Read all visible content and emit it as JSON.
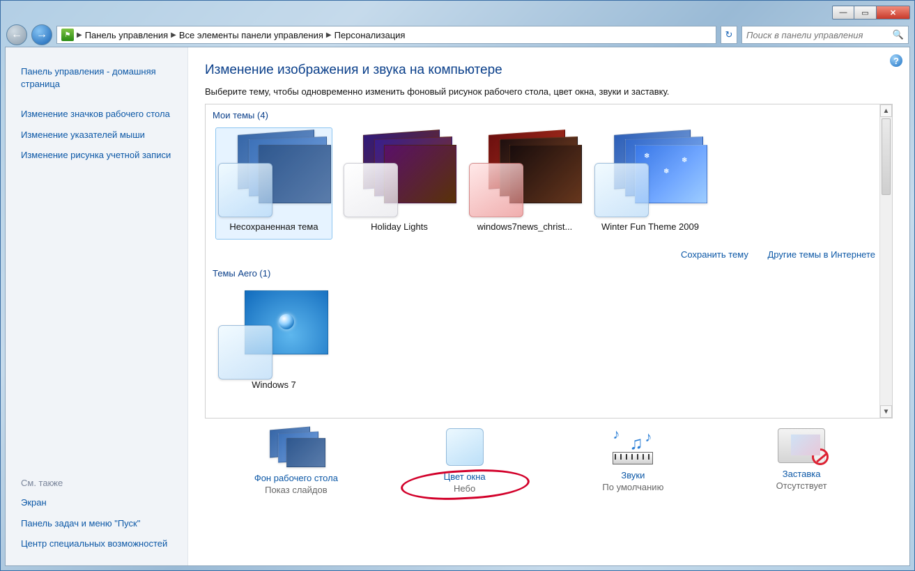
{
  "breadcrumb": {
    "items": [
      "Панель управления",
      "Все элементы панели управления",
      "Персонализация"
    ]
  },
  "search": {
    "placeholder": "Поиск в панели управления"
  },
  "sidebar": {
    "home": "Панель управления - домашняя страница",
    "links": {
      "l0": "Изменение значков рабочего стола",
      "l1": "Изменение указателей мыши",
      "l2": "Изменение рисунка учетной записи"
    },
    "see_also_label": "См. также",
    "see_also": {
      "s0": "Экран",
      "s1": "Панель задач и меню \"Пуск\"",
      "s2": "Центр специальных возможностей"
    }
  },
  "main": {
    "title": "Изменение изображения и звука на компьютере",
    "desc": "Выберите тему, чтобы одновременно изменить фоновый рисунок рабочего стола, цвет окна, звуки и заставку.",
    "group_my": "Мои темы (4)",
    "group_aero": "Темы Aero (1)",
    "themes_my": {
      "t0": "Несохраненная тема",
      "t1": "Holiday Lights",
      "t2": "windows7news_christ...",
      "t3": "Winter Fun Theme 2009"
    },
    "themes_aero": {
      "t0": "Windows 7"
    },
    "link_save": "Сохранить тему",
    "link_more": "Другие темы в Интернете"
  },
  "bottom": {
    "bg": {
      "title": "Фон рабочего стола",
      "sub": "Показ слайдов"
    },
    "color": {
      "title": "Цвет окна",
      "sub": "Небо"
    },
    "sound": {
      "title": "Звуки",
      "sub": "По умолчанию"
    },
    "ss": {
      "title": "Заставка",
      "sub": "Отсутствует"
    }
  },
  "winbuttons": {
    "min": "—",
    "max": "▭",
    "close": "✕"
  },
  "icons": {
    "back": "←",
    "fwd": "→",
    "sep": "▶",
    "refresh": "↻",
    "search": "🔍",
    "help": "?",
    "up": "▲",
    "down": "▼"
  }
}
